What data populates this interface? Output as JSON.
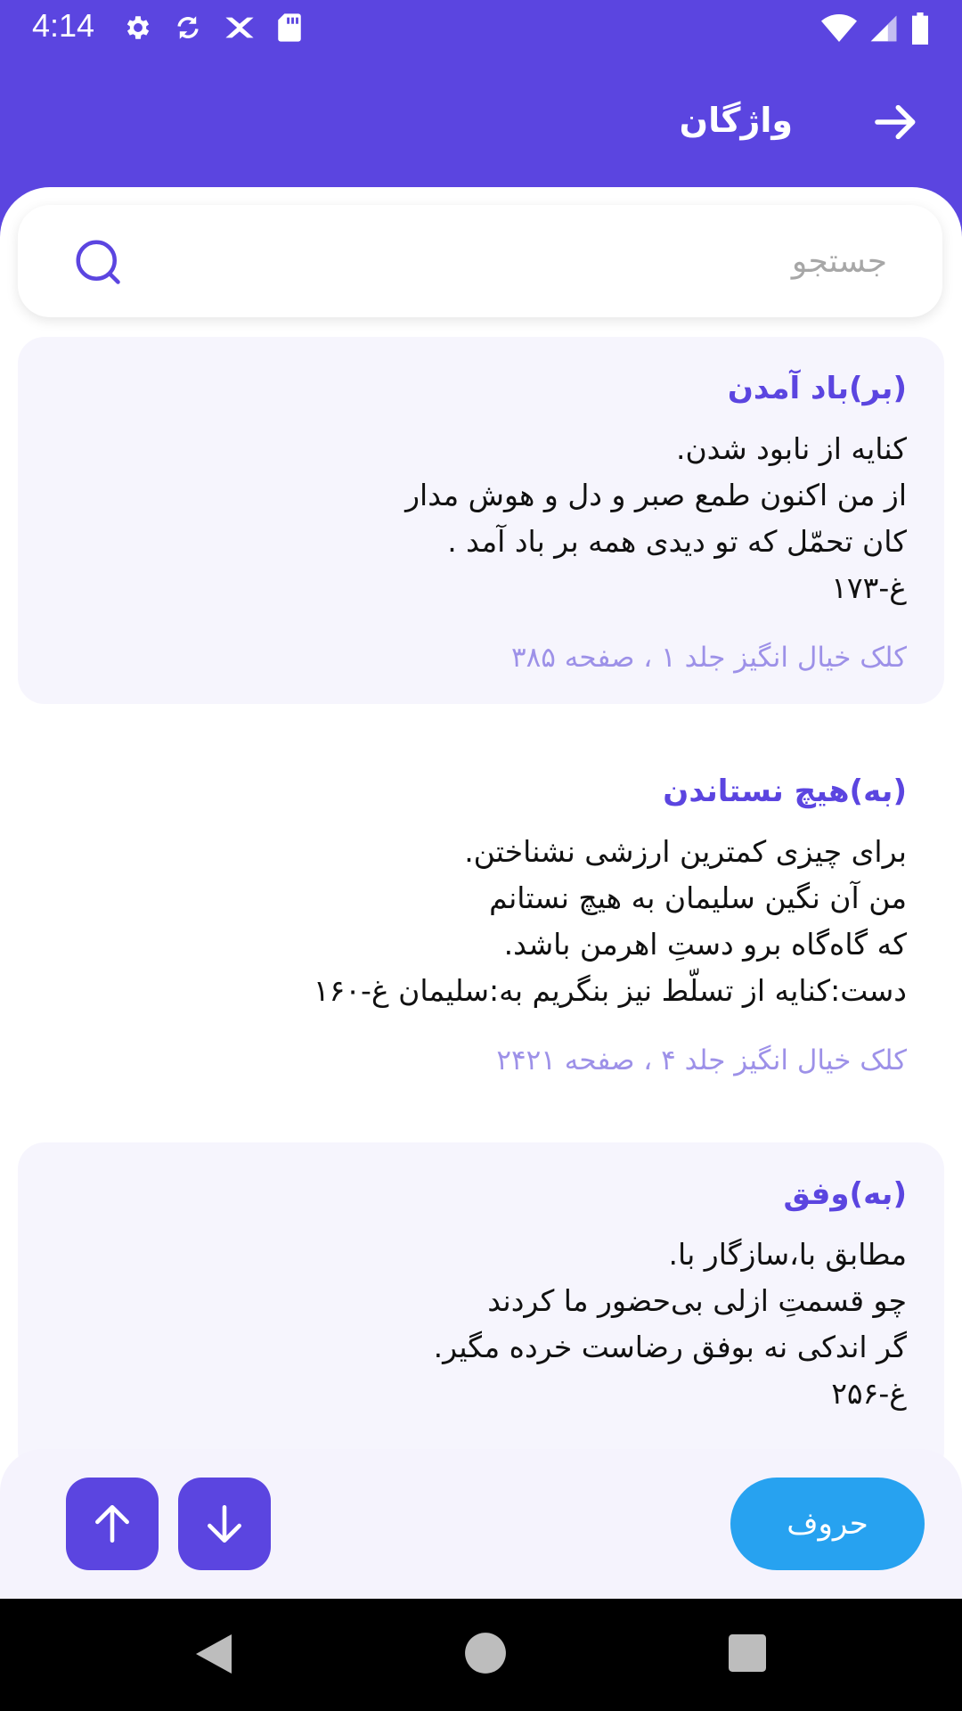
{
  "status_bar": {
    "time": "4:14",
    "icons_left": [
      "settings-icon",
      "sync-icon",
      "quran-app-icon",
      "sd-card-icon"
    ],
    "icons_right": [
      "wifi-icon",
      "signal-icon",
      "battery-icon"
    ]
  },
  "app_bar": {
    "title": "واژگان",
    "back_icon": "arrow-right-icon"
  },
  "search": {
    "placeholder": "جستجو",
    "value": ""
  },
  "entries": [
    {
      "title": "(بر)باد آمدن",
      "body": "کنایه از نابود شدن.\nاز من اکنون طمع صبر و دل و هوش مدار\nکان تحمّل که تو دیدی همه بر باد آمد .\n غ-۱۷۳",
      "source": "کلک خیال انگیز جلد ۱ ، صفحه ۳۸۵"
    },
    {
      "title": "(به)هیچ نستاندن",
      "body": "برای چیزی کمترین ارزشی نشناختن.\nمن آن نگین سلیمان به هیچ نستانم\n که گاه‌گاه برو دستِ اهرمن باشد.\n دست:کنایه از تسلّط نیز بنگریم به:سلیمان غ-۱۶۰",
      "source": "کلک خیال انگیز جلد ۴ ، صفحه ۲۴۲۱"
    },
    {
      "title": "(به)وفق",
      "body": "مطابق با،سازگار با.\nچو قسمتِ ازلی بی‌حضور ما کردند\n گر اندکی نه بوفق رضاست خرده مگیر.\n غ-۲۵۶",
      "source": ""
    }
  ],
  "bottom_bar": {
    "letters_label": "حروف",
    "up_icon": "arrow-up-icon",
    "down_icon": "arrow-down-icon"
  },
  "colors": {
    "primary": "#5b45e0",
    "accent": "#27a2f0",
    "source_text": "#9d91e8"
  }
}
